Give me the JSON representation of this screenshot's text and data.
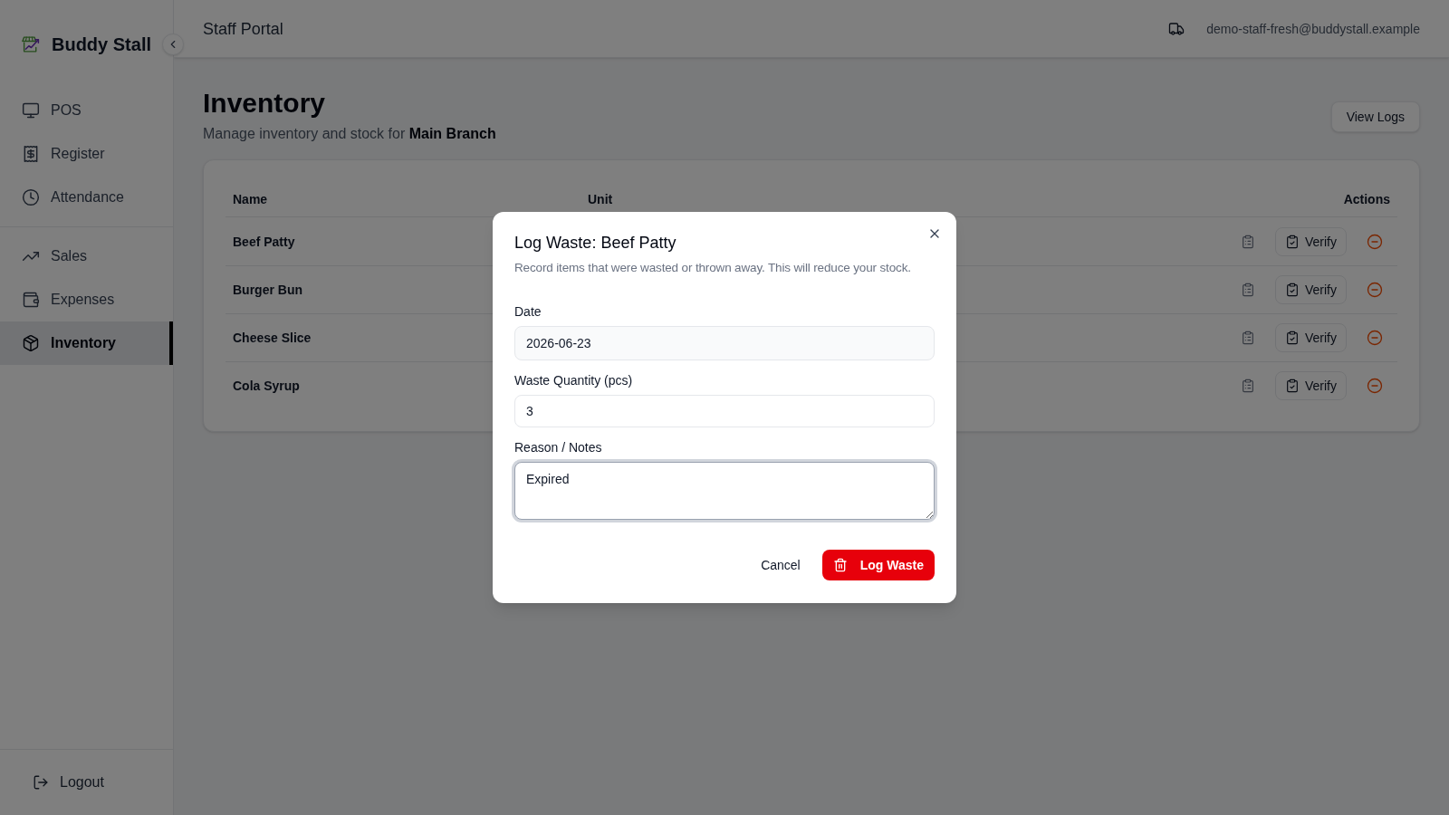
{
  "sidebar": {
    "brand": "Buddy Stall",
    "sections": [
      {
        "items": [
          {
            "label": "POS",
            "selected": false
          },
          {
            "label": "Register",
            "selected": false
          },
          {
            "label": "Attendance",
            "selected": false
          }
        ]
      },
      {
        "items": [
          {
            "label": "Sales",
            "selected": false
          },
          {
            "label": "Expenses",
            "selected": false
          },
          {
            "label": "Inventory",
            "selected": true
          }
        ]
      }
    ],
    "logout": "Logout"
  },
  "topbar": {
    "title": "Staff Portal",
    "user_email": "demo-staff-fresh@buddystall.example"
  },
  "page": {
    "title": "Inventory",
    "subtitle": "Manage inventory and stock for **Main Branch**",
    "view_logs_button": "View Logs"
  },
  "table": {
    "columns": [
      "Name",
      "Unit",
      "Actions"
    ],
    "rows": [
      {
        "name": "Beef Patty",
        "verify_button": "Verify"
      },
      {
        "name": "Burger Bun",
        "verify_button": "Verify"
      },
      {
        "name": "Cheese Slice",
        "verify_button": "Verify"
      },
      {
        "name": "Cola Syrup",
        "verify_button": "Verify"
      }
    ]
  },
  "dialog": {
    "title": "Log Waste: Beef Patty",
    "description": "Record items that were wasted or thrown away. This will reduce your stock.",
    "fields": [
      {
        "kind": "date",
        "label": "Date",
        "value": "2026-06-23",
        "focused": false
      },
      {
        "kind": "number",
        "label": "Waste Quantity (pcs)",
        "value": "3",
        "focused": false
      },
      {
        "kind": "textarea",
        "label": "Reason / Notes",
        "value": "Expired",
        "focused": true
      }
    ],
    "cancel_button": "Cancel",
    "submit_button": "Log Waste"
  }
}
